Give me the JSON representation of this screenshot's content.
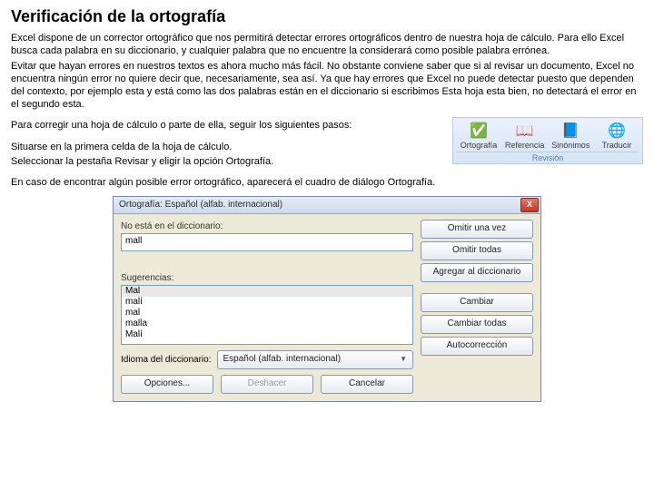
{
  "title": "Verificación de la ortografía",
  "intro": [
    "Excel dispone de un corrector ortográfico que nos permitirá detectar errores ortográficos dentro de nuestra hoja de cálculo. Para ello Excel busca cada palabra en su diccionario, y cualquier palabra que no encuentre la considerará como posible palabra errónea.",
    "Evitar que hayan errores en nuestros textos es ahora mucho más fácil. No obstante conviene saber que si al revisar un documento, Excel no encuentra ningún error no quiere decir que, necesariamente, sea así. Ya que hay errores que Excel no puede detectar puesto que dependen del contexto, por ejemplo esta y está como las dos palabras están en el diccionario si escribimos Esta hoja esta bien, no detectará el error en el segundo esta."
  ],
  "steps_intro": "Para corregir una hoja de cálculo o parte de ella, seguir los siguientes pasos:",
  "steps": [
    "Situarse en la primera celda de la hoja de cálculo.",
    "Seleccionar la pestaña Revisar y eligir la opción Ortografía."
  ],
  "ribbon": {
    "items": [
      {
        "icon": "✅",
        "label": "Ortografía"
      },
      {
        "icon": "📖",
        "label": "Referencia"
      },
      {
        "icon": "📘",
        "label": "Sinónimos"
      },
      {
        "icon": "🌐",
        "label": "Traducir"
      }
    ],
    "group": "Revisión"
  },
  "conclusion": "En caso de encontrar algún posible error ortográfico, aparecerá el cuadro de diálogo Ortografía.",
  "dialog": {
    "title": "Ortografía: Español (alfab. internacional)",
    "not_in_dict_label": "No está en el diccionario:",
    "not_in_dict_value": "mall",
    "suggestions_label": "Sugerencias:",
    "suggestions": [
      "Mal",
      "malí",
      "mal",
      "malla",
      "Malí"
    ],
    "lang_label": "Idioma del diccionario:",
    "lang_value": "Español (alfab. internacional)",
    "buttons": {
      "ignore_once": "Omitir una vez",
      "ignore_all": "Omitir todas",
      "add": "Agregar al diccionario",
      "change": "Cambiar",
      "change_all": "Cambiar todas",
      "autocorrect": "Autocorrección",
      "options": "Opciones...",
      "undo": "Deshacer",
      "cancel": "Cancelar"
    }
  }
}
